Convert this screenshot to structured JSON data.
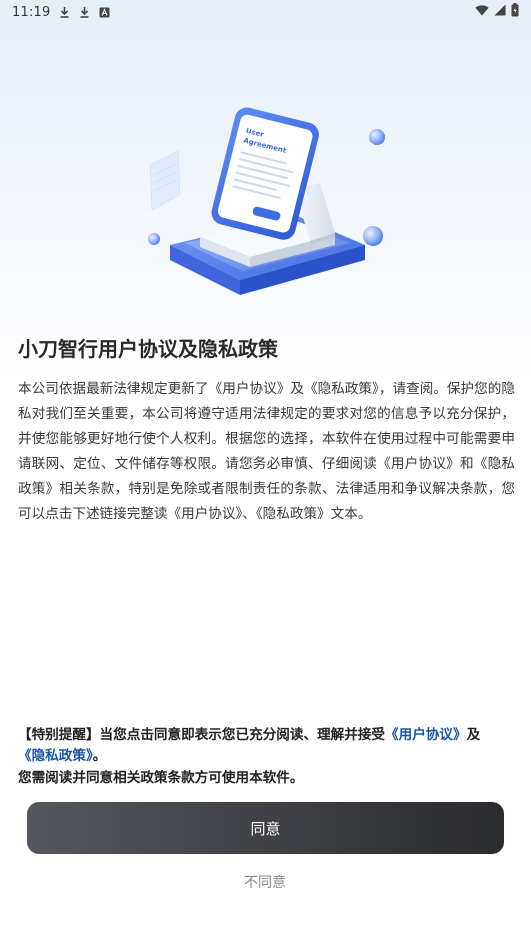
{
  "status_bar": {
    "time": "11:19",
    "icons_left": [
      "download-icon",
      "download-icon",
      "a-letter-icon"
    ],
    "icons_right": [
      "wifi-icon",
      "signal-icon",
      "battery-icon"
    ]
  },
  "hero": {
    "card_text_line1": "User",
    "card_text_line2": "Agreement",
    "accent_color": "#3d6fe0"
  },
  "dialog": {
    "title": "小刀智行用户协议及隐私政策",
    "body": "本公司依据最新法律规定更新了《用户协议》及《隐私政策》，请查阅。保护您的隐私对我们至关重要，本公司将遵守适用法律规定的要求对您的信息予以充分保护，并使您能够更好地行使个人权利。根据您的选择，本软件在使用过程中可能需要申请联网、定位、文件储存等权限。请您务必审慎、仔细阅读《用户协议》和《隐私政策》相关条款，特别是免除或者限制责任的条款、法律适用和争议解决条款，您可以点击下述链接完整读《用户协议》、《隐私政策》文本。",
    "notice_prefix": "【特别提醒】当您点击同意即表示您已充分阅读、理解并接受",
    "link_user_agreement": "《用户协议》",
    "notice_and": "及",
    "link_privacy_policy": "《隐私政策》",
    "notice_end": "。",
    "notice_line2": "您需阅读并同意相关政策条款方可使用本软件。",
    "agree_label": "同意",
    "disagree_label": "不同意",
    "link_color": "#1a56a8"
  }
}
